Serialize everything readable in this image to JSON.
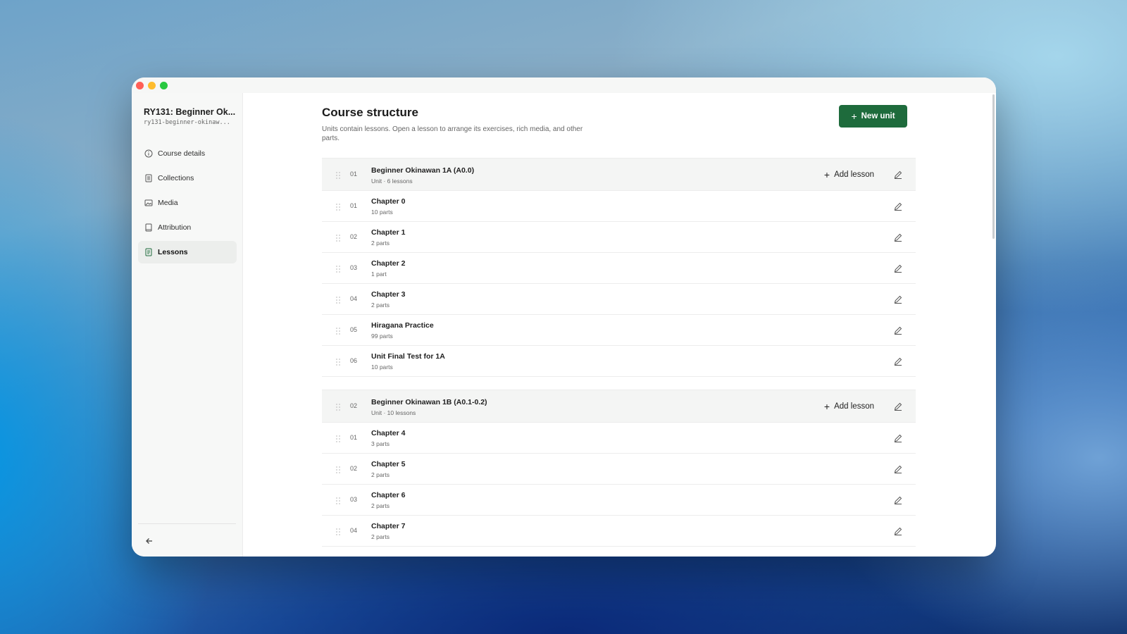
{
  "sidebar": {
    "course_title": "RY131: Beginner Ok...",
    "course_slug": "ry131-beginner-okinaw...",
    "items": [
      {
        "label": "Course details",
        "icon": "info-icon"
      },
      {
        "label": "Collections",
        "icon": "list-icon"
      },
      {
        "label": "Media",
        "icon": "image-icon"
      },
      {
        "label": "Attribution",
        "icon": "book-icon"
      },
      {
        "label": "Lessons",
        "icon": "document-icon",
        "active": true
      }
    ]
  },
  "main": {
    "title": "Course structure",
    "description": "Units contain lessons. Open a lesson to arrange its exercises, rich media, and other parts.",
    "new_unit_label": "New unit",
    "add_lesson_label": "Add lesson",
    "units": [
      {
        "number": "01",
        "title": "Beginner Okinawan 1A (A0.0)",
        "meta": "Unit · 6 lessons",
        "lessons": [
          {
            "number": "01",
            "title": "Chapter 0",
            "parts": "10 parts"
          },
          {
            "number": "02",
            "title": "Chapter 1",
            "parts": "2 parts"
          },
          {
            "number": "03",
            "title": "Chapter 2",
            "parts": "1 part"
          },
          {
            "number": "04",
            "title": "Chapter 3",
            "parts": "2 parts"
          },
          {
            "number": "05",
            "title": "Hiragana Practice",
            "parts": "99 parts"
          },
          {
            "number": "06",
            "title": "Unit Final Test for 1A",
            "parts": "10 parts"
          }
        ]
      },
      {
        "number": "02",
        "title": "Beginner Okinawan 1B (A0.1-0.2)",
        "meta": "Unit · 10 lessons",
        "lessons": [
          {
            "number": "01",
            "title": "Chapter 4",
            "parts": "3 parts"
          },
          {
            "number": "02",
            "title": "Chapter 5",
            "parts": "2 parts"
          },
          {
            "number": "03",
            "title": "Chapter 6",
            "parts": "2 parts"
          },
          {
            "number": "04",
            "title": "Chapter 7",
            "parts": "2 parts"
          }
        ]
      }
    ]
  },
  "colors": {
    "accent": "#1e6b3c",
    "sidebar_bg": "#f7f8f7",
    "unit_header_bg": "#f4f5f4"
  }
}
